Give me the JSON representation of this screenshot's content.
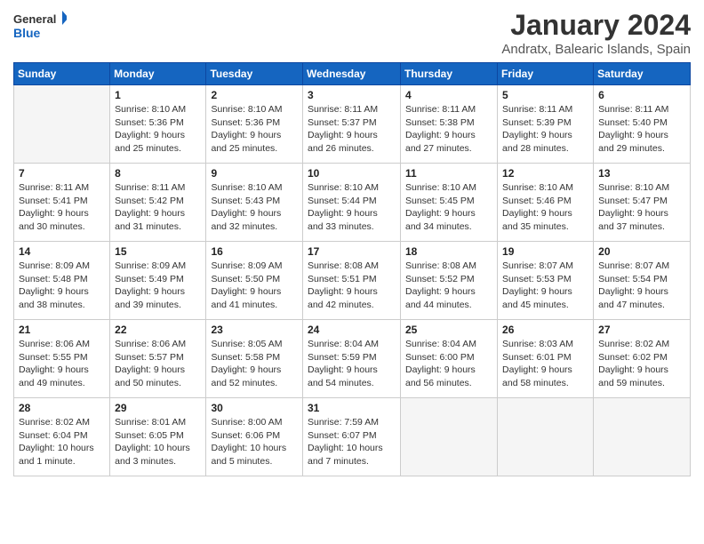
{
  "logo": {
    "general": "General",
    "blue": "Blue"
  },
  "title": "January 2024",
  "location": "Andratx, Balearic Islands, Spain",
  "headers": [
    "Sunday",
    "Monday",
    "Tuesday",
    "Wednesday",
    "Thursday",
    "Friday",
    "Saturday"
  ],
  "weeks": [
    [
      {
        "day": "",
        "info": ""
      },
      {
        "day": "1",
        "info": "Sunrise: 8:10 AM\nSunset: 5:36 PM\nDaylight: 9 hours\nand 25 minutes."
      },
      {
        "day": "2",
        "info": "Sunrise: 8:10 AM\nSunset: 5:36 PM\nDaylight: 9 hours\nand 25 minutes."
      },
      {
        "day": "3",
        "info": "Sunrise: 8:11 AM\nSunset: 5:37 PM\nDaylight: 9 hours\nand 26 minutes."
      },
      {
        "day": "4",
        "info": "Sunrise: 8:11 AM\nSunset: 5:38 PM\nDaylight: 9 hours\nand 27 minutes."
      },
      {
        "day": "5",
        "info": "Sunrise: 8:11 AM\nSunset: 5:39 PM\nDaylight: 9 hours\nand 28 minutes."
      },
      {
        "day": "6",
        "info": "Sunrise: 8:11 AM\nSunset: 5:40 PM\nDaylight: 9 hours\nand 29 minutes."
      }
    ],
    [
      {
        "day": "7",
        "info": "Sunrise: 8:11 AM\nSunset: 5:41 PM\nDaylight: 9 hours\nand 30 minutes."
      },
      {
        "day": "8",
        "info": "Sunrise: 8:11 AM\nSunset: 5:42 PM\nDaylight: 9 hours\nand 31 minutes."
      },
      {
        "day": "9",
        "info": "Sunrise: 8:10 AM\nSunset: 5:43 PM\nDaylight: 9 hours\nand 32 minutes."
      },
      {
        "day": "10",
        "info": "Sunrise: 8:10 AM\nSunset: 5:44 PM\nDaylight: 9 hours\nand 33 minutes."
      },
      {
        "day": "11",
        "info": "Sunrise: 8:10 AM\nSunset: 5:45 PM\nDaylight: 9 hours\nand 34 minutes."
      },
      {
        "day": "12",
        "info": "Sunrise: 8:10 AM\nSunset: 5:46 PM\nDaylight: 9 hours\nand 35 minutes."
      },
      {
        "day": "13",
        "info": "Sunrise: 8:10 AM\nSunset: 5:47 PM\nDaylight: 9 hours\nand 37 minutes."
      }
    ],
    [
      {
        "day": "14",
        "info": "Sunrise: 8:09 AM\nSunset: 5:48 PM\nDaylight: 9 hours\nand 38 minutes."
      },
      {
        "day": "15",
        "info": "Sunrise: 8:09 AM\nSunset: 5:49 PM\nDaylight: 9 hours\nand 39 minutes."
      },
      {
        "day": "16",
        "info": "Sunrise: 8:09 AM\nSunset: 5:50 PM\nDaylight: 9 hours\nand 41 minutes."
      },
      {
        "day": "17",
        "info": "Sunrise: 8:08 AM\nSunset: 5:51 PM\nDaylight: 9 hours\nand 42 minutes."
      },
      {
        "day": "18",
        "info": "Sunrise: 8:08 AM\nSunset: 5:52 PM\nDaylight: 9 hours\nand 44 minutes."
      },
      {
        "day": "19",
        "info": "Sunrise: 8:07 AM\nSunset: 5:53 PM\nDaylight: 9 hours\nand 45 minutes."
      },
      {
        "day": "20",
        "info": "Sunrise: 8:07 AM\nSunset: 5:54 PM\nDaylight: 9 hours\nand 47 minutes."
      }
    ],
    [
      {
        "day": "21",
        "info": "Sunrise: 8:06 AM\nSunset: 5:55 PM\nDaylight: 9 hours\nand 49 minutes."
      },
      {
        "day": "22",
        "info": "Sunrise: 8:06 AM\nSunset: 5:57 PM\nDaylight: 9 hours\nand 50 minutes."
      },
      {
        "day": "23",
        "info": "Sunrise: 8:05 AM\nSunset: 5:58 PM\nDaylight: 9 hours\nand 52 minutes."
      },
      {
        "day": "24",
        "info": "Sunrise: 8:04 AM\nSunset: 5:59 PM\nDaylight: 9 hours\nand 54 minutes."
      },
      {
        "day": "25",
        "info": "Sunrise: 8:04 AM\nSunset: 6:00 PM\nDaylight: 9 hours\nand 56 minutes."
      },
      {
        "day": "26",
        "info": "Sunrise: 8:03 AM\nSunset: 6:01 PM\nDaylight: 9 hours\nand 58 minutes."
      },
      {
        "day": "27",
        "info": "Sunrise: 8:02 AM\nSunset: 6:02 PM\nDaylight: 9 hours\nand 59 minutes."
      }
    ],
    [
      {
        "day": "28",
        "info": "Sunrise: 8:02 AM\nSunset: 6:04 PM\nDaylight: 10 hours\nand 1 minute."
      },
      {
        "day": "29",
        "info": "Sunrise: 8:01 AM\nSunset: 6:05 PM\nDaylight: 10 hours\nand 3 minutes."
      },
      {
        "day": "30",
        "info": "Sunrise: 8:00 AM\nSunset: 6:06 PM\nDaylight: 10 hours\nand 5 minutes."
      },
      {
        "day": "31",
        "info": "Sunrise: 7:59 AM\nSunset: 6:07 PM\nDaylight: 10 hours\nand 7 minutes."
      },
      {
        "day": "",
        "info": ""
      },
      {
        "day": "",
        "info": ""
      },
      {
        "day": "",
        "info": ""
      }
    ]
  ]
}
